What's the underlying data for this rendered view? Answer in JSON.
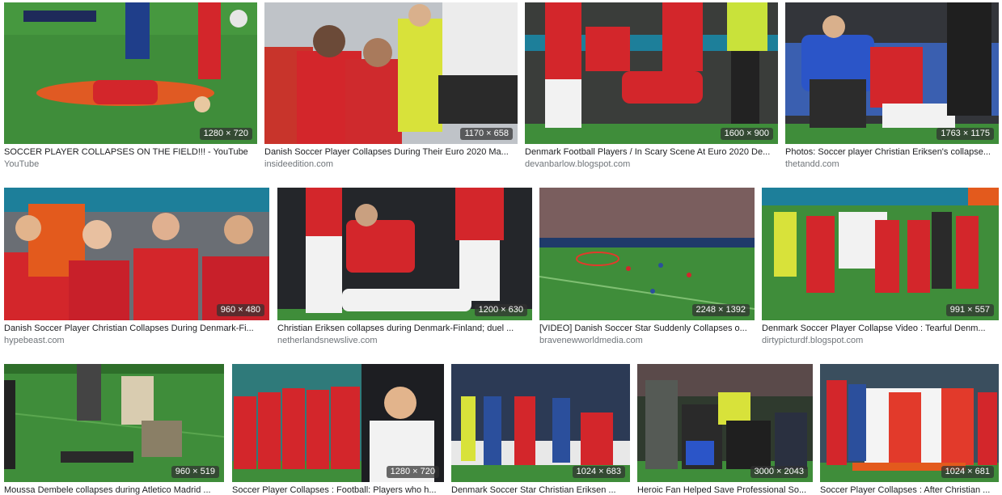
{
  "colors": {
    "pitch": "#3f8d3a",
    "pitch_dark": "#2f6f2c",
    "denmark_red": "#d3262b",
    "white_kit": "#f2f2f2",
    "blue_kit": "#2b4f9c",
    "medic": "#e23a2b",
    "crowd": "#5a4a4a",
    "text": "#202124",
    "source": "#70757a"
  },
  "results": [
    {
      "title": "SOCCER PLAYER COLLAPSES ON THE FIELD!!! - YouTube",
      "source": "YouTube",
      "dimensions": "1280 × 720",
      "thumb_icon": "player-lying-on-pitch-icon"
    },
    {
      "title": "Danish Soccer Player Collapses During Their Euro 2020 Ma...",
      "source": "insideedition.com",
      "dimensions": "1170 × 658",
      "thumb_icon": "players-and-medic-icon"
    },
    {
      "title": "Denmark Football Players / In Scary Scene At Euro 2020 De...",
      "source": "devanbarlow.blogspot.com",
      "dimensions": "1600 × 900",
      "thumb_icon": "players-huddle-icon"
    },
    {
      "title": "Photos: Soccer player Christian Eriksen's collapse...",
      "source": "thetandd.com",
      "dimensions": "1763 × 1175",
      "thumb_icon": "medics-kneeling-icon"
    },
    {
      "title": "Danish Soccer Player Christian Collapses During Denmark-Fi...",
      "source": "hypebeast.com",
      "dimensions": "960 × 480",
      "thumb_icon": "players-covering-faces-icon"
    },
    {
      "title": "Christian Eriksen collapses during Denmark-Finland; duel ...",
      "source": "netherlandsnewslive.com",
      "dimensions": "1200 × 630",
      "thumb_icon": "player-down-icon"
    },
    {
      "title": "[VIDEO] Danish Soccer Star Suddenly Collapses o...",
      "source": "bravenewworldmedia.com",
      "dimensions": "2248 × 1392",
      "thumb_icon": "stadium-wide-view-icon"
    },
    {
      "title": "Denmark Soccer Player Collapse Video : Tearful Denm...",
      "source": "dirtypicturdf.blogspot.com",
      "dimensions": "991 × 557",
      "thumb_icon": "team-standing-icon"
    },
    {
      "title": "Moussa Dembele collapses during Atletico Madrid ...",
      "source": "",
      "dimensions": "960 × 519",
      "thumb_icon": "player-on-grass-icon"
    },
    {
      "title": "Soccer Player Collapses : Football: Players who h...",
      "source": "",
      "dimensions": "1280 × 720",
      "thumb_icon": "team-and-portrait-icon"
    },
    {
      "title": "Denmark Soccer Star Christian Eriksen ...",
      "source": "",
      "dimensions": "1024 × 683",
      "thumb_icon": "players-on-pitch-icon"
    },
    {
      "title": "Heroic Fan Helped Save Professional So...",
      "source": "",
      "dimensions": "3000 × 2043",
      "thumb_icon": "crowd-and-medics-icon"
    },
    {
      "title": "Soccer Player Collapses : After Christian ...",
      "source": "",
      "dimensions": "1024 × 681",
      "thumb_icon": "medics-with-sheet-icon"
    }
  ]
}
